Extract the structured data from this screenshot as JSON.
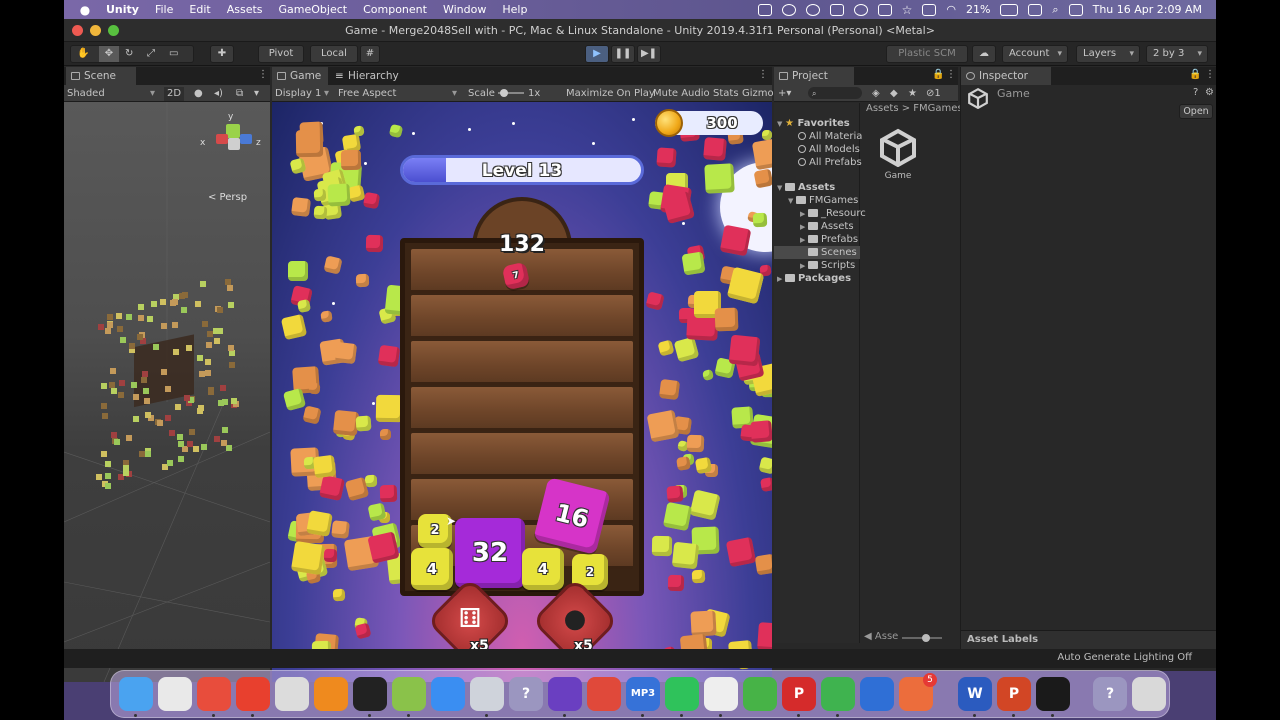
{
  "menubar": {
    "apple": "",
    "items": [
      "Unity",
      "File",
      "Edit",
      "Assets",
      "GameObject",
      "Component",
      "Window",
      "Help"
    ],
    "battery": "21%",
    "clock": "Thu 16 Apr  2:09 AM"
  },
  "window": {
    "title": "Game - Merge2048Sell with - PC, Mac & Linux Standalone - Unity 2019.4.31f1 Personal (Personal) <Metal>"
  },
  "toolbar": {
    "pivot": "Pivot",
    "local": "Local",
    "plastic": "Plastic SCM",
    "account": "Account",
    "layers": "Layers",
    "layout": "2 by 3"
  },
  "scene": {
    "tab": "Scene",
    "shading": "Shaded",
    "mode2d": "2D",
    "persp": "< Persp",
    "gizmo": {
      "y": "y",
      "x": "x",
      "z": "z"
    }
  },
  "game": {
    "tab": "Game",
    "hierarchy_tab": "Hierarchy",
    "display": "Display 1",
    "aspect": "Free Aspect",
    "scale_label": "Scale",
    "scale_value": "1x",
    "maximize": "Maximize On Play",
    "mute": "Mute Audio",
    "stats": "Stats",
    "gizmos": "Gizmo",
    "level": "Level 13",
    "level_progress": 0.18,
    "coins": "300",
    "score": "132",
    "falling_cube": "7",
    "cubes": [
      {
        "label": "2",
        "color": "#e7e23a"
      },
      {
        "label": "4",
        "color": "#e7e23a"
      },
      {
        "label": "32",
        "color": "#a52ad9"
      },
      {
        "label": "4",
        "color": "#e7e23a"
      },
      {
        "label": "2",
        "color": "#e7e23a"
      },
      {
        "label": "16",
        "color": "#d634c8"
      }
    ],
    "powerups": [
      {
        "icon": "dice-icon",
        "count": "x5"
      },
      {
        "icon": "bomb-icon",
        "count": "x5"
      }
    ]
  },
  "project": {
    "tab": "Project",
    "favorites": "Favorites",
    "fav_items": [
      "All Materia",
      "All Models",
      "All Prefabs"
    ],
    "assets": "Assets",
    "fmgames": "FMGames",
    "sub_items": [
      "_Resourc",
      "Assets",
      "Prefabs",
      "Scenes",
      "Scripts"
    ],
    "packages": "Packages",
    "breadcrumb": [
      "Assets",
      "FMGames"
    ],
    "asset_item": "Game",
    "slider_label": "Asse"
  },
  "inspector": {
    "tab": "Inspector",
    "object": "Game",
    "open": "Open",
    "labels": "Asset Labels"
  },
  "statusbar": {
    "lighting": "Auto Generate Lighting Off"
  },
  "dock": {
    "badge": "5",
    "apps": [
      {
        "name": "finder-icon",
        "color": "#4aa3f0",
        "glyph": ""
      },
      {
        "name": "launchpad-icon",
        "color": "#e9e9e9",
        "glyph": ""
      },
      {
        "name": "chrome-icon",
        "color": "#e84d3c",
        "glyph": ""
      },
      {
        "name": "anydesk-icon",
        "color": "#e8402e",
        "glyph": ""
      },
      {
        "name": "gitkraken-icon",
        "color": "#dcdcdc",
        "glyph": ""
      },
      {
        "name": "blender-icon",
        "color": "#ef8a1e",
        "glyph": ""
      },
      {
        "name": "activity-monitor-icon",
        "color": "#222",
        "glyph": ""
      },
      {
        "name": "android-studio-icon",
        "color": "#8ac24a",
        "glyph": ""
      },
      {
        "name": "safari-icon",
        "color": "#3a8ef2",
        "glyph": ""
      },
      {
        "name": "unity-hub-icon",
        "color": "#cfd3db",
        "glyph": ""
      },
      {
        "name": "help-icon",
        "color": "#9b96c0",
        "glyph": "?"
      },
      {
        "name": "visual-studio-icon",
        "color": "#6a3fc1",
        "glyph": ""
      },
      {
        "name": "remote-desktop-icon",
        "color": "#e0493a",
        "glyph": ""
      },
      {
        "name": "mp3-icon",
        "color": "#3672d8",
        "glyph": "MP3"
      },
      {
        "name": "whatsapp-icon",
        "color": "#2fc25b",
        "glyph": ""
      },
      {
        "name": "freeform-icon",
        "color": "#eeeeee",
        "glyph": ""
      },
      {
        "name": "dictionary-icon",
        "color": "#47b347",
        "glyph": ""
      },
      {
        "name": "toolbox-icon",
        "color": "#d52b2b",
        "glyph": "P"
      },
      {
        "name": "facetime-icon",
        "color": "#3fb34f",
        "glyph": ""
      },
      {
        "name": "virtualbox-icon",
        "color": "#2f6fd6",
        "glyph": ""
      },
      {
        "name": "app-store-icon",
        "color": "#ec6d3c",
        "glyph": ""
      },
      {
        "name": "word-icon",
        "color": "#2b5bbf",
        "glyph": "W"
      },
      {
        "name": "powerpoint-icon",
        "color": "#d24625",
        "glyph": "P"
      },
      {
        "name": "unity-icon",
        "color": "#1a1a1a",
        "glyph": ""
      },
      {
        "name": "help-icon-2",
        "color": "#9b96c0",
        "glyph": "?"
      },
      {
        "name": "trash-icon",
        "color": "#d9d9d9",
        "glyph": ""
      }
    ]
  }
}
